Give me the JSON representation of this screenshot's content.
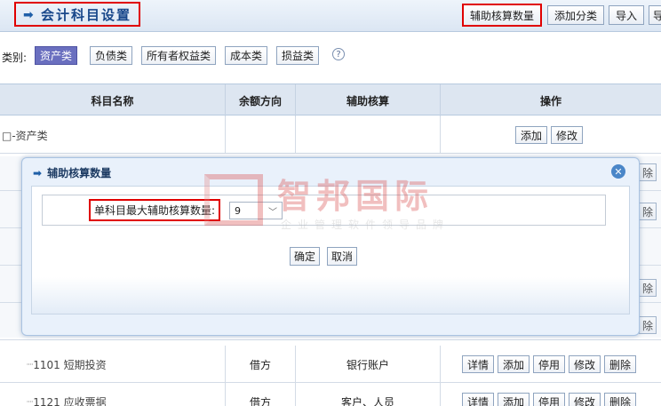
{
  "header": {
    "title": "会计科目设置",
    "buttons": [
      "辅助核算数量",
      "添加分类",
      "导入",
      "导"
    ]
  },
  "categories": {
    "label": "类别:",
    "items": [
      "资产类",
      "负债类",
      "所有者权益类",
      "成本类",
      "损益类"
    ],
    "active": "资产类",
    "help": "?"
  },
  "table": {
    "columns": [
      "科目名称",
      "余额方向",
      "辅助核算",
      "操作"
    ],
    "rows": [
      {
        "name": "□-资产类",
        "direction": "",
        "aux": "",
        "actions": [
          "添加",
          "修改"
        ]
      },
      {
        "name": "1101  短期投资",
        "direction": "借方",
        "aux": "银行账户",
        "actions": [
          "详情",
          "添加",
          "停用",
          "修改",
          "删除"
        ]
      },
      {
        "name": "1121  应收票据",
        "direction": "借方",
        "aux": "客户、人员",
        "actions": [
          "详情",
          "添加",
          "停用",
          "修改",
          "删除"
        ]
      }
    ],
    "partial_delete": "除"
  },
  "modal": {
    "title": "辅助核算数量",
    "close": "✕",
    "field_label": "单科目最大辅助核算数量:",
    "select_value": "9",
    "ok": "确定",
    "cancel": "取消"
  },
  "watermark": {
    "name": "智邦国际",
    "tagline": "企业管理软件领导品牌"
  },
  "colors": {
    "accent": "#18478a",
    "highlight_border": "#e00000",
    "active_tab": "#6a6fbf"
  }
}
